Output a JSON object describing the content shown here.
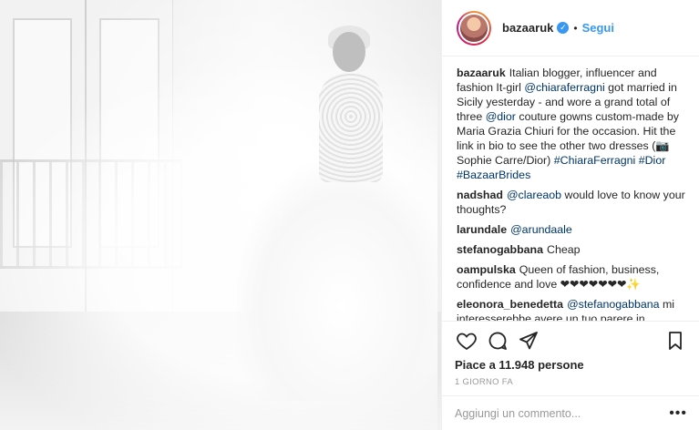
{
  "post": {
    "username": "bazaaruk",
    "follow_label": "Segui",
    "dot": "•",
    "caption": {
      "user": "bazaaruk",
      "text_pre": "Italian blogger, influencer and fashion It-girl ",
      "mention1": "@chiaraferragni",
      "text_mid": " got married in Sicily yesterday - and wore a grand total of three ",
      "mention2": "@dior",
      "text_post": " couture gowns custom-made by Maria Grazia Chiuri for the occasion. Hit the link in bio to see the other two dresses (📷 Sophie Carre/Dior) ",
      "tags": "#ChiaraFerragni #Dior #BazaarBrides"
    },
    "comments": [
      {
        "user": "nadshad",
        "mention": "@clareaob",
        "text": " would love to know your thoughts?"
      },
      {
        "user": "larundale",
        "mention": "@arundaale",
        "text": ""
      },
      {
        "user": "stefanogabbana",
        "mention": "",
        "text": "Cheap"
      },
      {
        "user": "oampulska",
        "mention": "",
        "text": "Queen of fashion, business, confidence and love ❤❤❤❤❤❤❤✨"
      },
      {
        "user": "eleonora_benedetta",
        "mention": "@stefanogabbana",
        "text": " mi interesserebbe avere un tuo parere in"
      }
    ],
    "likes": "Piace a 11.948 persone",
    "time": "1 GIORNO FA",
    "comment_placeholder": "Aggiungi un commento...",
    "more": "•••"
  }
}
